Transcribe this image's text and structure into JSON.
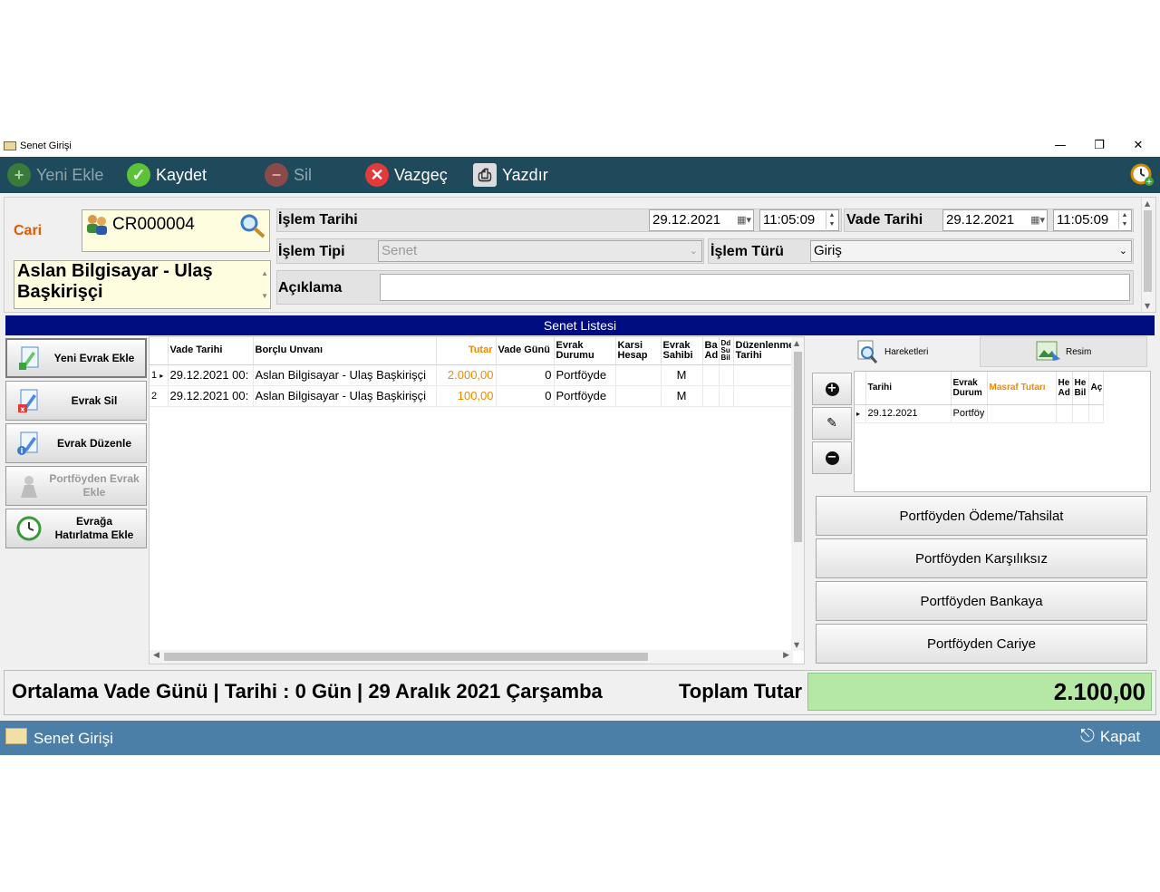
{
  "window": {
    "title": "Senet Girişi",
    "minimize": "—",
    "restore": "❐",
    "close": "✕"
  },
  "toolbar": {
    "new_label": "Yeni Ekle",
    "save_label": "Kaydet",
    "delete_label": "Sil",
    "cancel_label": "Vazgeç",
    "print_label": "Yazdır"
  },
  "header": {
    "cari_label": "Cari",
    "cari_code": "CR000004",
    "cari_name": "Aslan Bilgisayar - Ulaş Başkirişçi",
    "islem_tarihi_label": "İşlem Tarihi",
    "islem_tarihi_date": "29.12.2021",
    "islem_tarihi_time": "11:05:09",
    "vade_tarihi_label": "Vade Tarihi",
    "vade_tarihi_date": "29.12.2021",
    "vade_tarihi_time": "11:05:09",
    "islem_tipi_label": "İşlem Tipi",
    "islem_tipi_value": "Senet",
    "islem_turu_label": "İşlem Türü",
    "islem_turu_value": "Giriş",
    "aciklama_label": "Açıklama",
    "aciklama_value": ""
  },
  "section_title": "Senet Listesi",
  "sidebar": [
    {
      "label": "Yeni Evrak Ekle"
    },
    {
      "label": "Evrak Sil"
    },
    {
      "label": "Evrak Düzenle"
    },
    {
      "label": "Portföyden Evrak Ekle"
    },
    {
      "label": "Evrağa Hatırlatma Ekle"
    }
  ],
  "grid": {
    "columns": [
      "Vade Tarihi",
      "Borçlu Unvanı",
      "Tutar",
      "Vade Günü",
      "Evrak Durumu",
      "Karsi Hesap",
      "Evrak Sahibi",
      "Ba Ad",
      "Dd Su Bil",
      "Düzenlenme Tarihi"
    ],
    "rows": [
      {
        "no": "1",
        "vade": "29.12.2021 00:",
        "borclu": "Aslan Bilgisayar - Ulaş Başkirişçi",
        "tutar": "2.000,00",
        "gun": "0",
        "durum": "Portföyde",
        "karsi": "",
        "sahibi": "M"
      },
      {
        "no": "2",
        "vade": "29.12.2021 00:",
        "borclu": "Aslan Bilgisayar - Ulaş Başkirişçi",
        "tutar": "100,00",
        "gun": "0",
        "durum": "Portföyde",
        "karsi": "",
        "sahibi": "M"
      }
    ]
  },
  "right_tabs": {
    "hareketleri": "Hareketleri",
    "resim": "Resim"
  },
  "subgrid": {
    "columns": [
      "Tarihi",
      "Evrak Durum",
      "Masraf Tutarı",
      "He Ad",
      "He Bil",
      "Aç"
    ],
    "rows": [
      {
        "tarih": "29.12.2021",
        "durum": "Portföy"
      }
    ]
  },
  "actions": [
    "Portföyden Ödeme/Tahsilat",
    "Portföyden Karşılıksız",
    "Portföyden Bankaya",
    "Portföyden Cariye"
  ],
  "footer": {
    "average_text": "Ortalama Vade Günü | Tarihi : 0 Gün | 29 Aralık 2021 Çarşamba",
    "total_label": "Toplam Tutar",
    "total_value": "2.100,00"
  },
  "statusbar": {
    "title": "Senet Girişi",
    "close_label": "Kapat"
  },
  "colors": {
    "toolbar": "#1e4a5c",
    "section_head": "#000d80",
    "status": "#4b7fa8",
    "total_bg": "#b4e8a4",
    "accent_orange": "#f08a00"
  }
}
